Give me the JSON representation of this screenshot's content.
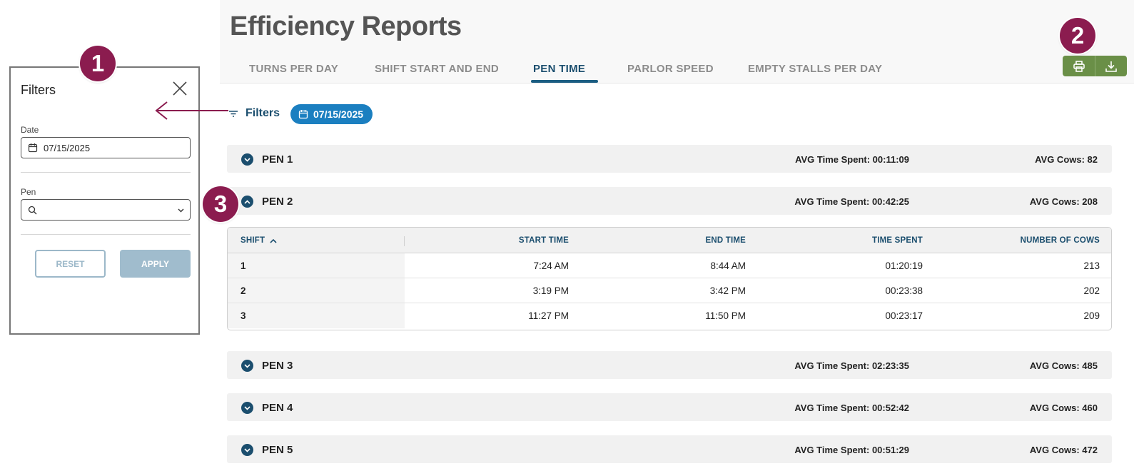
{
  "page_title": "Efficiency Reports",
  "tabs": [
    {
      "label": "TURNS PER DAY",
      "active": false
    },
    {
      "label": "SHIFT START AND END",
      "active": false
    },
    {
      "label": "PEN TIME",
      "active": true
    },
    {
      "label": "PARLOR SPEED",
      "active": false
    },
    {
      "label": "EMPTY STALLS PER DAY",
      "active": false
    }
  ],
  "actions": {
    "print_icon": "printer-icon",
    "download_icon": "download-icon"
  },
  "filter_bar": {
    "filters_label": "Filters",
    "date_chip": "07/15/2025"
  },
  "pens": [
    {
      "name": "PEN 1",
      "avg_time": "AVG Time Spent: 00:11:09",
      "avg_cows": "AVG Cows: 82",
      "expanded": false
    },
    {
      "name": "PEN 2",
      "avg_time": "AVG Time Spent: 00:42:25",
      "avg_cows": "AVG Cows: 208",
      "expanded": true
    },
    {
      "name": "PEN 3",
      "avg_time": "AVG Time Spent: 02:23:35",
      "avg_cows": "AVG Cows: 485",
      "expanded": false
    },
    {
      "name": "PEN 4",
      "avg_time": "AVG Time Spent: 00:52:42",
      "avg_cows": "AVG Cows: 460",
      "expanded": false
    },
    {
      "name": "PEN 5",
      "avg_time": "AVG Time Spent: 00:51:29",
      "avg_cows": "AVG Cows: 472",
      "expanded": false
    }
  ],
  "pen_table": {
    "headers": [
      "SHIFT",
      "START TIME",
      "END TIME",
      "TIME SPENT",
      "NUMBER OF COWS"
    ],
    "rows": [
      [
        "1",
        "7:24 AM",
        "8:44 AM",
        "01:20:19",
        "213"
      ],
      [
        "2",
        "3:19 PM",
        "3:42 PM",
        "00:23:38",
        "202"
      ],
      [
        "3",
        "11:27 PM",
        "11:50 PM",
        "00:23:17",
        "209"
      ]
    ]
  },
  "filters_panel": {
    "title": "Filters",
    "date_label": "Date",
    "date_value": "07/15/2025",
    "pen_label": "Pen",
    "pen_value": "",
    "reset_label": "RESET",
    "apply_label": "APPLY"
  },
  "callouts": [
    "1",
    "2",
    "3"
  ],
  "colors": {
    "brand_blue": "#1b4e6e",
    "chip_blue": "#1b7fc0",
    "action_green": "#6a8f47",
    "callout_maroon": "#8b1c4f"
  }
}
